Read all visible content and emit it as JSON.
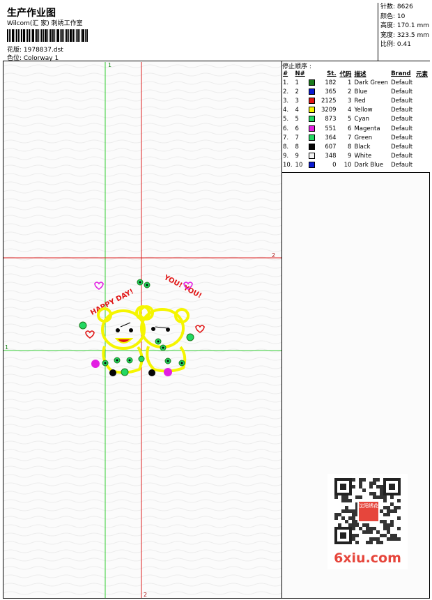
{
  "header": {
    "title": "生产作业图",
    "subtitle": "Wilcom(汇 家) 刺绣工作室",
    "design_label": "花版: 1978837.dst",
    "colorway_label": "色位:  Colorway 1"
  },
  "stats": {
    "stitches": "针数: 8626",
    "colors": "颜色: 10",
    "height": "高度: 170.1 mm",
    "width": "宽度: 323.5 mm",
    "scale": "比例: 0.41"
  },
  "thread_panel": {
    "title": "停止顺序 :",
    "columns": [
      "#",
      "N#",
      "St.",
      "代码",
      "描述",
      "Brand",
      "元素"
    ],
    "rows": [
      {
        "idx": "1.",
        "n": "1",
        "color": "#1a7a1a",
        "st": "182",
        "code": "1",
        "desc": "Dark Green",
        "brand": "Default"
      },
      {
        "idx": "2.",
        "n": "2",
        "color": "#0a1ad2",
        "st": "365",
        "code": "2",
        "desc": "Blue",
        "brand": "Default"
      },
      {
        "idx": "3.",
        "n": "3",
        "color": "#e01414",
        "st": "2125",
        "code": "3",
        "desc": "Red",
        "brand": "Default"
      },
      {
        "idx": "4.",
        "n": "4",
        "color": "#f5f500",
        "st": "3209",
        "code": "4",
        "desc": "Yellow",
        "brand": "Default"
      },
      {
        "idx": "5.",
        "n": "5",
        "color": "#22d862",
        "st": "873",
        "code": "5",
        "desc": "Cyan",
        "brand": "Default"
      },
      {
        "idx": "6.",
        "n": "6",
        "color": "#e21ee2",
        "st": "551",
        "code": "6",
        "desc": "Magenta",
        "brand": "Default"
      },
      {
        "idx": "7.",
        "n": "7",
        "color": "#22d862",
        "st": "364",
        "code": "7",
        "desc": "Green",
        "brand": "Default"
      },
      {
        "idx": "8.",
        "n": "8",
        "color": "#050505",
        "st": "607",
        "code": "8",
        "desc": "Black",
        "brand": "Default"
      },
      {
        "idx": "9.",
        "n": "9",
        "color": "#f2f2f2",
        "st": "348",
        "code": "9",
        "desc": "White",
        "brand": "Default"
      },
      {
        "idx": "10.",
        "n": "10",
        "color": "#0a1ad2",
        "st": "0",
        "code": "10",
        "desc": "Dark Blue",
        "brand": "Default"
      }
    ]
  },
  "canvas": {
    "guide_labels": {
      "green_v": "1",
      "green_h": "1",
      "red_h": "2",
      "red_v": "2"
    },
    "design_text_left": "HAPPY DAY!",
    "design_text_right": "YOU! YOU!"
  },
  "watermark": {
    "brand": "6xiu.com",
    "stamp": "沈阳绣花"
  },
  "colors": {
    "guide_green": "#33cc33",
    "guide_red": "#dd2222",
    "accent_red": "#e6463c"
  }
}
